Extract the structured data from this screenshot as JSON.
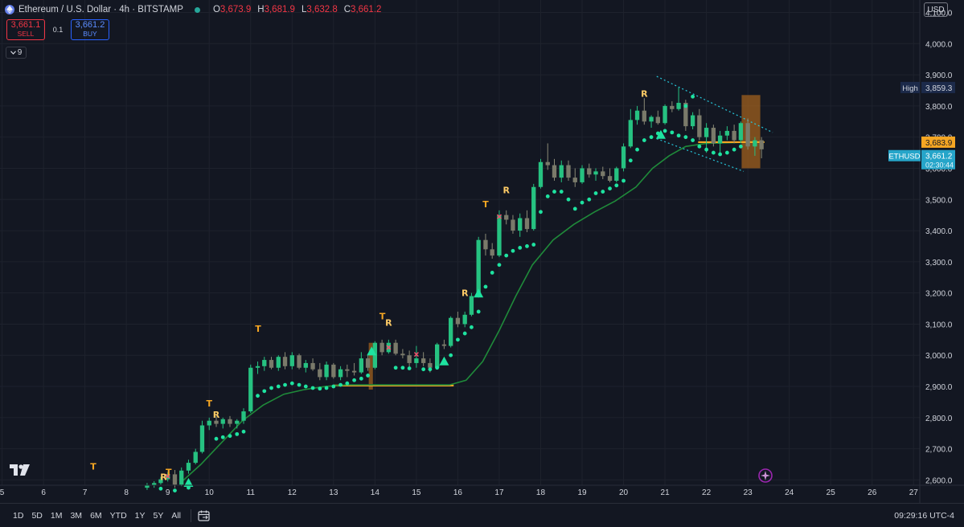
{
  "header": {
    "symbol": "Ethereum / U.S. Dollar · 4h · BITSTAMP",
    "open_label": "O",
    "open": "3,673.9",
    "high_label": "H",
    "high": "3,681.9",
    "low_label": "L",
    "low": "3,632.8",
    "close_label": "C",
    "close": "3,661.2"
  },
  "trade": {
    "sell_price": "3,661.1",
    "sell_label": "SELL",
    "spread": "0.1",
    "buy_price": "3,661.2",
    "buy_label": "BUY"
  },
  "indicators_toggle": "9",
  "currency": "USD",
  "bottom": {
    "ranges": [
      "1D",
      "5D",
      "1M",
      "3M",
      "6M",
      "YTD",
      "1Y",
      "5Y",
      "All"
    ],
    "clock": "09:29:16 UTC-4"
  },
  "icons": [
    "ethereum-icon",
    "live-dot-icon",
    "chevron-down-icon",
    "calendar-icon",
    "tradingview-logo-icon",
    "sparkle-icon"
  ],
  "colors": {
    "bg": "#131722",
    "up": "#26c281",
    "down": "#7a7a6a",
    "dot": "#1ee3a0",
    "ma": "#1f8a3a",
    "orange": "#f5a623",
    "text": "#d1d4dc",
    "grid": "#1e222d"
  },
  "chart_data": {
    "type": "candlestick",
    "y_ticks": [
      2600,
      2700,
      2800,
      2900,
      3000,
      3100,
      3200,
      3300,
      3400,
      3500,
      3600,
      3700,
      3800,
      3900,
      4000,
      4100
    ],
    "y_tick_labels": [
      "2,600.0",
      "2,700.0",
      "2,800.0",
      "2,900.0",
      "3,000.0",
      "3,100.0",
      "3,200.0",
      "3,300.0",
      "3,400.0",
      "3,500.0",
      "3,600.0",
      "3,700.0",
      "3,800.0",
      "3,900.0",
      "4,000.0",
      "4,100.0"
    ],
    "ylim": [
      2583,
      4140
    ],
    "x_ticks": [
      5,
      6,
      7,
      8,
      9,
      10,
      11,
      12,
      13,
      14,
      15,
      16,
      17,
      18,
      19,
      20,
      21,
      22,
      23,
      24,
      25,
      26,
      27
    ],
    "x_tick_labels": [
      "5",
      "6",
      "7",
      "8",
      "9",
      "10",
      "11",
      "12",
      "13",
      "14",
      "15",
      "16",
      "17",
      "18",
      "19",
      "20",
      "21",
      "22",
      "23",
      "24",
      "25",
      "26",
      "27"
    ],
    "xlim": [
      4.95,
      27.15
    ],
    "price_labels": [
      {
        "label": "High",
        "value": "3,859.3",
        "price": 3859.3,
        "style": "high"
      },
      {
        "label": "",
        "value": "3,683.9",
        "price": 3683.9,
        "style": "orange"
      },
      {
        "label": "ETHUSD",
        "value": "3,661.2",
        "sub": "02:30:44",
        "price": 3661.2,
        "style": "last"
      }
    ],
    "candles": [
      [
        8.5,
        2575,
        2590,
        2568,
        2582
      ],
      [
        8.67,
        2582,
        2596,
        2575,
        2590
      ],
      [
        8.83,
        2590,
        2610,
        2585,
        2602
      ],
      [
        9.0,
        2602,
        2625,
        2595,
        2618
      ],
      [
        9.17,
        2618,
        2632,
        2575,
        2585
      ],
      [
        9.33,
        2585,
        2640,
        2580,
        2630
      ],
      [
        9.5,
        2630,
        2665,
        2620,
        2655
      ],
      [
        9.67,
        2655,
        2700,
        2650,
        2690
      ],
      [
        9.83,
        2690,
        2790,
        2685,
        2775
      ],
      [
        10.0,
        2775,
        2800,
        2760,
        2790
      ],
      [
        10.17,
        2790,
        2805,
        2770,
        2780
      ],
      [
        10.33,
        2780,
        2800,
        2765,
        2795
      ],
      [
        10.5,
        2795,
        2805,
        2770,
        2780
      ],
      [
        10.67,
        2780,
        2795,
        2765,
        2790
      ],
      [
        10.83,
        2790,
        2830,
        2780,
        2820
      ],
      [
        11.0,
        2820,
        2970,
        2815,
        2960
      ],
      [
        11.17,
        2960,
        2980,
        2940,
        2965
      ],
      [
        11.33,
        2965,
        2995,
        2950,
        2985
      ],
      [
        11.5,
        2985,
        2995,
        2955,
        2960
      ],
      [
        11.67,
        2960,
        3000,
        2950,
        2995
      ],
      [
        11.83,
        2995,
        3010,
        2955,
        2965
      ],
      [
        12.0,
        2965,
        3010,
        2955,
        3000
      ],
      [
        12.17,
        3000,
        3005,
        2955,
        2960
      ],
      [
        12.33,
        2960,
        2985,
        2945,
        2975
      ],
      [
        12.5,
        2975,
        2990,
        2950,
        2955
      ],
      [
        12.67,
        2955,
        2975,
        2920,
        2930
      ],
      [
        12.83,
        2930,
        2980,
        2920,
        2970
      ],
      [
        13.0,
        2970,
        2975,
        2925,
        2930
      ],
      [
        13.17,
        2930,
        2965,
        2920,
        2955
      ],
      [
        13.33,
        2955,
        2970,
        2930,
        2950
      ],
      [
        13.5,
        2950,
        2975,
        2935,
        2945
      ],
      [
        13.67,
        2945,
        3010,
        2940,
        2990
      ],
      [
        13.83,
        2990,
        3005,
        2950,
        2960
      ],
      [
        14.0,
        2960,
        3045,
        2955,
        3040
      ],
      [
        14.17,
        3040,
        3050,
        3000,
        3010
      ],
      [
        14.33,
        3010,
        3050,
        3005,
        3040
      ],
      [
        14.5,
        3040,
        3050,
        3000,
        3005
      ],
      [
        14.67,
        3005,
        3020,
        2990,
        3000
      ],
      [
        14.83,
        3000,
        3015,
        2960,
        2975
      ],
      [
        15.0,
        2975,
        3030,
        2960,
        2990
      ],
      [
        15.17,
        2990,
        3010,
        2965,
        2975
      ],
      [
        15.33,
        2975,
        2990,
        2945,
        2960
      ],
      [
        15.5,
        2960,
        3040,
        2955,
        3035
      ],
      [
        15.67,
        3035,
        3050,
        3020,
        3030
      ],
      [
        15.83,
        3030,
        3125,
        3025,
        3120
      ],
      [
        16.0,
        3120,
        3140,
        3090,
        3100
      ],
      [
        16.17,
        3100,
        3140,
        3090,
        3130
      ],
      [
        16.33,
        3130,
        3200,
        3125,
        3190
      ],
      [
        16.5,
        3190,
        3380,
        3185,
        3370
      ],
      [
        16.67,
        3370,
        3390,
        3320,
        3340
      ],
      [
        16.83,
        3340,
        3360,
        3310,
        3320
      ],
      [
        17.0,
        3320,
        3465,
        3315,
        3450
      ],
      [
        17.17,
        3450,
        3465,
        3420,
        3435
      ],
      [
        17.33,
        3435,
        3450,
        3390,
        3400
      ],
      [
        17.5,
        3400,
        3455,
        3380,
        3440
      ],
      [
        17.67,
        3440,
        3465,
        3395,
        3405
      ],
      [
        17.83,
        3405,
        3550,
        3400,
        3540
      ],
      [
        18.0,
        3540,
        3630,
        3535,
        3620
      ],
      [
        18.17,
        3620,
        3680,
        3595,
        3610
      ],
      [
        18.33,
        3610,
        3630,
        3560,
        3570
      ],
      [
        18.5,
        3570,
        3625,
        3555,
        3610
      ],
      [
        18.67,
        3610,
        3625,
        3560,
        3570
      ],
      [
        18.83,
        3570,
        3600,
        3540,
        3555
      ],
      [
        19.0,
        3555,
        3610,
        3550,
        3600
      ],
      [
        19.17,
        3600,
        3615,
        3570,
        3580
      ],
      [
        19.33,
        3580,
        3600,
        3560,
        3590
      ],
      [
        19.5,
        3590,
        3605,
        3565,
        3575
      ],
      [
        19.67,
        3575,
        3600,
        3555,
        3560
      ],
      [
        19.83,
        3560,
        3605,
        3555,
        3600
      ],
      [
        20.0,
        3600,
        3680,
        3590,
        3670
      ],
      [
        20.17,
        3670,
        3790,
        3665,
        3755
      ],
      [
        20.33,
        3755,
        3800,
        3740,
        3785
      ],
      [
        20.5,
        3785,
        3825,
        3740,
        3750
      ],
      [
        20.67,
        3750,
        3770,
        3730,
        3765
      ],
      [
        20.83,
        3765,
        3785,
        3740,
        3745
      ],
      [
        21.0,
        3745,
        3805,
        3740,
        3800
      ],
      [
        21.17,
        3800,
        3815,
        3780,
        3790
      ],
      [
        21.33,
        3790,
        3859,
        3785,
        3810
      ],
      [
        21.5,
        3810,
        3820,
        3720,
        3735
      ],
      [
        21.67,
        3735,
        3780,
        3725,
        3770
      ],
      [
        21.83,
        3770,
        3790,
        3690,
        3700
      ],
      [
        22.0,
        3700,
        3745,
        3650,
        3730
      ],
      [
        22.17,
        3730,
        3740,
        3670,
        3680
      ],
      [
        22.33,
        3680,
        3720,
        3640,
        3705
      ],
      [
        22.5,
        3705,
        3735,
        3690,
        3720
      ],
      [
        22.67,
        3720,
        3740,
        3680,
        3690
      ],
      [
        22.83,
        3690,
        3750,
        3680,
        3745
      ],
      [
        23.0,
        3745,
        3760,
        3660,
        3670
      ],
      [
        23.17,
        3670,
        3700,
        3640,
        3690
      ],
      [
        23.33,
        3690,
        3700,
        3632,
        3661
      ]
    ],
    "ma": [
      [
        9.3,
        2590
      ],
      [
        9.8,
        2650
      ],
      [
        10.3,
        2720
      ],
      [
        10.8,
        2790
      ],
      [
        11.3,
        2840
      ],
      [
        11.8,
        2875
      ],
      [
        12.3,
        2890
      ],
      [
        12.8,
        2900
      ],
      [
        13.3,
        2905
      ],
      [
        14.0,
        2905
      ],
      [
        15.0,
        2905
      ],
      [
        15.8,
        2905
      ],
      [
        16.2,
        2920
      ],
      [
        16.6,
        2980
      ],
      [
        17.0,
        3080
      ],
      [
        17.4,
        3190
      ],
      [
        17.8,
        3290
      ],
      [
        18.3,
        3370
      ],
      [
        18.8,
        3420
      ],
      [
        19.3,
        3460
      ],
      [
        19.8,
        3495
      ],
      [
        20.3,
        3540
      ],
      [
        20.7,
        3600
      ],
      [
        21.1,
        3640
      ],
      [
        21.5,
        3670
      ],
      [
        22.0,
        3680
      ],
      [
        22.8,
        3683
      ],
      [
        23.4,
        3684
      ]
    ],
    "support_line": {
      "from": 13.0,
      "to": 15.9,
      "price": 2903
    },
    "current_line": {
      "from": 21.8,
      "to": 23.4,
      "price": 3683.9
    },
    "channel": {
      "top": [
        [
          20.8,
          3895
        ],
        [
          23.6,
          3715
        ]
      ],
      "bottom": [
        [
          20.8,
          3695
        ],
        [
          22.9,
          3590
        ]
      ]
    },
    "boxes": [
      {
        "x0": 13.85,
        "x1": 13.95,
        "y0": 2890,
        "y1": 3040
      },
      {
        "x0": 22.85,
        "x1": 23.3,
        "y0": 3600,
        "y1": 3835
      }
    ],
    "labels": [
      {
        "text": "T",
        "x": 7.2,
        "price": 2633,
        "color": "orange"
      },
      {
        "text": "R",
        "x": 8.9,
        "price": 2600,
        "color": "yellow"
      },
      {
        "text": "T",
        "x": 9.02,
        "price": 2615,
        "color": "orange"
      },
      {
        "text": "T",
        "x": 10.0,
        "price": 2835,
        "color": "orange"
      },
      {
        "text": "R",
        "x": 10.17,
        "price": 2800,
        "color": "yellow"
      },
      {
        "text": "T",
        "x": 11.18,
        "price": 3075,
        "color": "orange"
      },
      {
        "text": "T",
        "x": 14.18,
        "price": 3115,
        "color": "orange"
      },
      {
        "text": "R",
        "x": 14.33,
        "price": 3095,
        "color": "yellow"
      },
      {
        "text": "R",
        "x": 16.17,
        "price": 3190,
        "color": "yellow"
      },
      {
        "text": "T",
        "x": 16.67,
        "price": 3475,
        "color": "orange"
      },
      {
        "text": "R",
        "x": 17.17,
        "price": 3520,
        "color": "yellow"
      },
      {
        "text": "R",
        "x": 20.5,
        "price": 3830,
        "color": "yellow"
      }
    ],
    "triangles": [
      [
        9.5,
        2588
      ],
      [
        13.92,
        3010
      ],
      [
        15.67,
        2978
      ],
      [
        16.5,
        3196
      ],
      [
        20.9,
        3705
      ]
    ],
    "crosses": [
      [
        9.0,
        2612
      ],
      [
        14.33,
        3025
      ],
      [
        15.0,
        3003
      ],
      [
        17.0,
        3445
      ]
    ],
    "dots": [
      [
        8.83,
        2572
      ],
      [
        9.17,
        2566
      ],
      [
        9.5,
        2575
      ],
      [
        10.17,
        2732
      ],
      [
        10.33,
        2737
      ],
      [
        10.5,
        2741
      ],
      [
        10.67,
        2747
      ],
      [
        10.83,
        2755
      ],
      [
        11.17,
        2870
      ],
      [
        11.33,
        2885
      ],
      [
        11.5,
        2895
      ],
      [
        11.67,
        2900
      ],
      [
        11.83,
        2905
      ],
      [
        12.0,
        2910
      ],
      [
        12.17,
        2905
      ],
      [
        12.33,
        2900
      ],
      [
        12.5,
        2895
      ],
      [
        12.67,
        2893
      ],
      [
        12.83,
        2895
      ],
      [
        13.0,
        2900
      ],
      [
        13.17,
        2905
      ],
      [
        13.33,
        2910
      ],
      [
        13.5,
        2920
      ],
      [
        13.67,
        2925
      ],
      [
        13.83,
        2935
      ],
      [
        14.5,
        2960
      ],
      [
        14.67,
        2960
      ],
      [
        14.83,
        2958
      ],
      [
        15.17,
        2955
      ],
      [
        15.33,
        2955
      ],
      [
        15.5,
        2960
      ],
      [
        15.83,
        3000
      ],
      [
        16.0,
        3050
      ],
      [
        16.17,
        3070
      ],
      [
        16.33,
        3090
      ],
      [
        16.5,
        3140
      ],
      [
        16.67,
        3220
      ],
      [
        16.83,
        3265
      ],
      [
        17.0,
        3290
      ],
      [
        17.17,
        3320
      ],
      [
        17.33,
        3335
      ],
      [
        17.5,
        3345
      ],
      [
        17.67,
        3350
      ],
      [
        17.83,
        3355
      ],
      [
        18.0,
        3460
      ],
      [
        18.17,
        3510
      ],
      [
        18.33,
        3525
      ],
      [
        18.5,
        3525
      ],
      [
        18.67,
        3500
      ],
      [
        18.83,
        3470
      ],
      [
        19.0,
        3490
      ],
      [
        19.17,
        3500
      ],
      [
        19.33,
        3520
      ],
      [
        19.5,
        3525
      ],
      [
        19.67,
        3535
      ],
      [
        19.83,
        3545
      ],
      [
        20.0,
        3560
      ],
      [
        20.17,
        3625
      ],
      [
        20.33,
        3660
      ],
      [
        20.5,
        3690
      ],
      [
        20.67,
        3700
      ],
      [
        20.83,
        3712
      ],
      [
        21.0,
        3720
      ],
      [
        21.17,
        3715
      ],
      [
        21.33,
        3705
      ],
      [
        21.5,
        3700
      ],
      [
        21.67,
        3690
      ],
      [
        21.83,
        3670
      ],
      [
        22.0,
        3660
      ],
      [
        22.17,
        3650
      ],
      [
        22.33,
        3645
      ],
      [
        22.5,
        3650
      ],
      [
        22.67,
        3660
      ],
      [
        22.83,
        3670
      ],
      [
        21.5,
        3800
      ],
      [
        21.67,
        3830
      ]
    ]
  }
}
